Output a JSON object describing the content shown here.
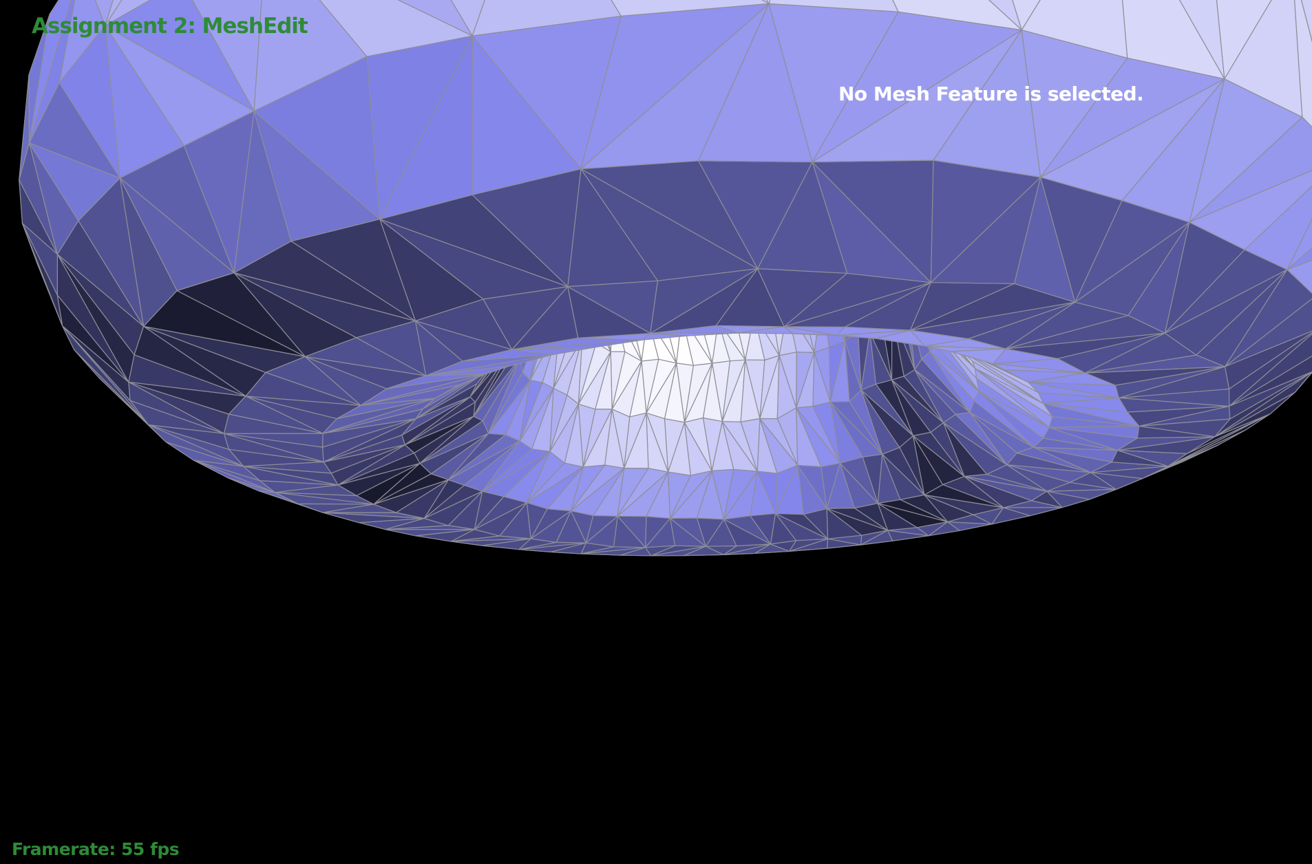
{
  "app": {
    "title": "Assignment 2: MeshEdit",
    "selection_status": "No Mesh Feature is selected.",
    "framerate": "Framerate: 55 fps"
  },
  "colors": {
    "background": "#000000",
    "hud_green": "#2e8b37",
    "status_white": "#ffffff",
    "mesh_edge": "#8e8e96",
    "mesh_light": "#ffffff",
    "mesh_mid": "#a8a9fb",
    "mesh_dark": "#1a1a2e"
  },
  "viewport": {
    "object": "torus-mesh"
  }
}
